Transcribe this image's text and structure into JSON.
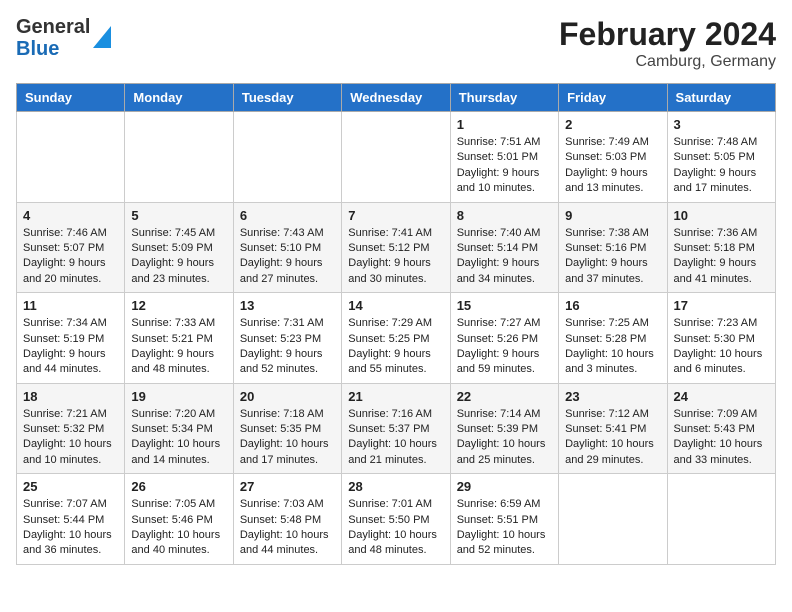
{
  "logo": {
    "line1": "General",
    "line2": "Blue"
  },
  "title": "February 2024",
  "subtitle": "Camburg, Germany",
  "days_of_week": [
    "Sunday",
    "Monday",
    "Tuesday",
    "Wednesday",
    "Thursday",
    "Friday",
    "Saturday"
  ],
  "weeks": [
    [
      {
        "day": "",
        "info": ""
      },
      {
        "day": "",
        "info": ""
      },
      {
        "day": "",
        "info": ""
      },
      {
        "day": "",
        "info": ""
      },
      {
        "day": "1",
        "info": "Sunrise: 7:51 AM\nSunset: 5:01 PM\nDaylight: 9 hours\nand 10 minutes."
      },
      {
        "day": "2",
        "info": "Sunrise: 7:49 AM\nSunset: 5:03 PM\nDaylight: 9 hours\nand 13 minutes."
      },
      {
        "day": "3",
        "info": "Sunrise: 7:48 AM\nSunset: 5:05 PM\nDaylight: 9 hours\nand 17 minutes."
      }
    ],
    [
      {
        "day": "4",
        "info": "Sunrise: 7:46 AM\nSunset: 5:07 PM\nDaylight: 9 hours\nand 20 minutes."
      },
      {
        "day": "5",
        "info": "Sunrise: 7:45 AM\nSunset: 5:09 PM\nDaylight: 9 hours\nand 23 minutes."
      },
      {
        "day": "6",
        "info": "Sunrise: 7:43 AM\nSunset: 5:10 PM\nDaylight: 9 hours\nand 27 minutes."
      },
      {
        "day": "7",
        "info": "Sunrise: 7:41 AM\nSunset: 5:12 PM\nDaylight: 9 hours\nand 30 minutes."
      },
      {
        "day": "8",
        "info": "Sunrise: 7:40 AM\nSunset: 5:14 PM\nDaylight: 9 hours\nand 34 minutes."
      },
      {
        "day": "9",
        "info": "Sunrise: 7:38 AM\nSunset: 5:16 PM\nDaylight: 9 hours\nand 37 minutes."
      },
      {
        "day": "10",
        "info": "Sunrise: 7:36 AM\nSunset: 5:18 PM\nDaylight: 9 hours\nand 41 minutes."
      }
    ],
    [
      {
        "day": "11",
        "info": "Sunrise: 7:34 AM\nSunset: 5:19 PM\nDaylight: 9 hours\nand 44 minutes."
      },
      {
        "day": "12",
        "info": "Sunrise: 7:33 AM\nSunset: 5:21 PM\nDaylight: 9 hours\nand 48 minutes."
      },
      {
        "day": "13",
        "info": "Sunrise: 7:31 AM\nSunset: 5:23 PM\nDaylight: 9 hours\nand 52 minutes."
      },
      {
        "day": "14",
        "info": "Sunrise: 7:29 AM\nSunset: 5:25 PM\nDaylight: 9 hours\nand 55 minutes."
      },
      {
        "day": "15",
        "info": "Sunrise: 7:27 AM\nSunset: 5:26 PM\nDaylight: 9 hours\nand 59 minutes."
      },
      {
        "day": "16",
        "info": "Sunrise: 7:25 AM\nSunset: 5:28 PM\nDaylight: 10 hours\nand 3 minutes."
      },
      {
        "day": "17",
        "info": "Sunrise: 7:23 AM\nSunset: 5:30 PM\nDaylight: 10 hours\nand 6 minutes."
      }
    ],
    [
      {
        "day": "18",
        "info": "Sunrise: 7:21 AM\nSunset: 5:32 PM\nDaylight: 10 hours\nand 10 minutes."
      },
      {
        "day": "19",
        "info": "Sunrise: 7:20 AM\nSunset: 5:34 PM\nDaylight: 10 hours\nand 14 minutes."
      },
      {
        "day": "20",
        "info": "Sunrise: 7:18 AM\nSunset: 5:35 PM\nDaylight: 10 hours\nand 17 minutes."
      },
      {
        "day": "21",
        "info": "Sunrise: 7:16 AM\nSunset: 5:37 PM\nDaylight: 10 hours\nand 21 minutes."
      },
      {
        "day": "22",
        "info": "Sunrise: 7:14 AM\nSunset: 5:39 PM\nDaylight: 10 hours\nand 25 minutes."
      },
      {
        "day": "23",
        "info": "Sunrise: 7:12 AM\nSunset: 5:41 PM\nDaylight: 10 hours\nand 29 minutes."
      },
      {
        "day": "24",
        "info": "Sunrise: 7:09 AM\nSunset: 5:43 PM\nDaylight: 10 hours\nand 33 minutes."
      }
    ],
    [
      {
        "day": "25",
        "info": "Sunrise: 7:07 AM\nSunset: 5:44 PM\nDaylight: 10 hours\nand 36 minutes."
      },
      {
        "day": "26",
        "info": "Sunrise: 7:05 AM\nSunset: 5:46 PM\nDaylight: 10 hours\nand 40 minutes."
      },
      {
        "day": "27",
        "info": "Sunrise: 7:03 AM\nSunset: 5:48 PM\nDaylight: 10 hours\nand 44 minutes."
      },
      {
        "day": "28",
        "info": "Sunrise: 7:01 AM\nSunset: 5:50 PM\nDaylight: 10 hours\nand 48 minutes."
      },
      {
        "day": "29",
        "info": "Sunrise: 6:59 AM\nSunset: 5:51 PM\nDaylight: 10 hours\nand 52 minutes."
      },
      {
        "day": "",
        "info": ""
      },
      {
        "day": "",
        "info": ""
      }
    ]
  ]
}
